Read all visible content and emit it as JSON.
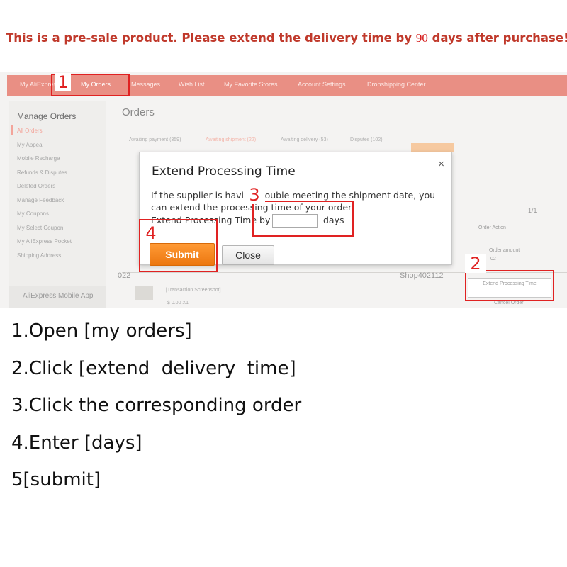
{
  "banner": {
    "text_before": "This is a pre-sale product. Please extend the delivery time by ",
    "days_value": "90",
    "text_after": " days after purchase!"
  },
  "screenshot": {
    "nav_tabs": [
      "My AliExpress",
      "My Orders",
      "Messages",
      "Wish List",
      "My Favorite Stores",
      "Account Settings",
      "Dropshipping Center"
    ],
    "sidebar": {
      "heading": "Manage Orders",
      "items": [
        "All Orders",
        "My Appeal",
        "Mobile Recharge",
        "Refunds & Disputes",
        "Deleted Orders",
        "Manage Feedback",
        "My Coupons",
        "My Select Coupon",
        "My AliExpress Pocket",
        "Shipping Address"
      ],
      "app_label": "AliExpress Mobile App"
    },
    "main_title": "Orders",
    "filters": [
      "Awaiting payment (359)",
      "Awaiting shipment (22)",
      "Awaiting delivery (53)",
      "Disputes (102)"
    ],
    "pager": "1/1",
    "order_action": "Order Action",
    "amount_label": "Order amount",
    "amount_value": "02",
    "order_id_left": "022",
    "order_id_right": "Shop402112",
    "transaction_snapshot": "[Transaction Screenshot]",
    "price": "$ 0.00 X1",
    "extend_button": "Extend Processing Time",
    "cancel_order": "Cancel Order"
  },
  "dialog": {
    "title": "Extend Processing Time",
    "close_icon": "×",
    "desc_line1": "If the supplier is having trouble meeting the shipment date, you",
    "desc_line2": "can extend the processing time of your order.",
    "extend_label": "Extend Processing Time by",
    "days_value": "",
    "days_label": "days",
    "submit": "Submit",
    "close": "Close"
  },
  "callouts": [
    "1",
    "2",
    "3",
    "4"
  ],
  "instructions": [
    "1.Open [my orders]",
    "2.Click [extend  delivery  time]",
    "3.Click the corresponding order",
    "4.Enter [days]",
    "5[submit]"
  ],
  "colors": {
    "banner": "#c0392b",
    "callout": "#e02222",
    "nav": "#e98f84",
    "submit": "#f0841f"
  }
}
